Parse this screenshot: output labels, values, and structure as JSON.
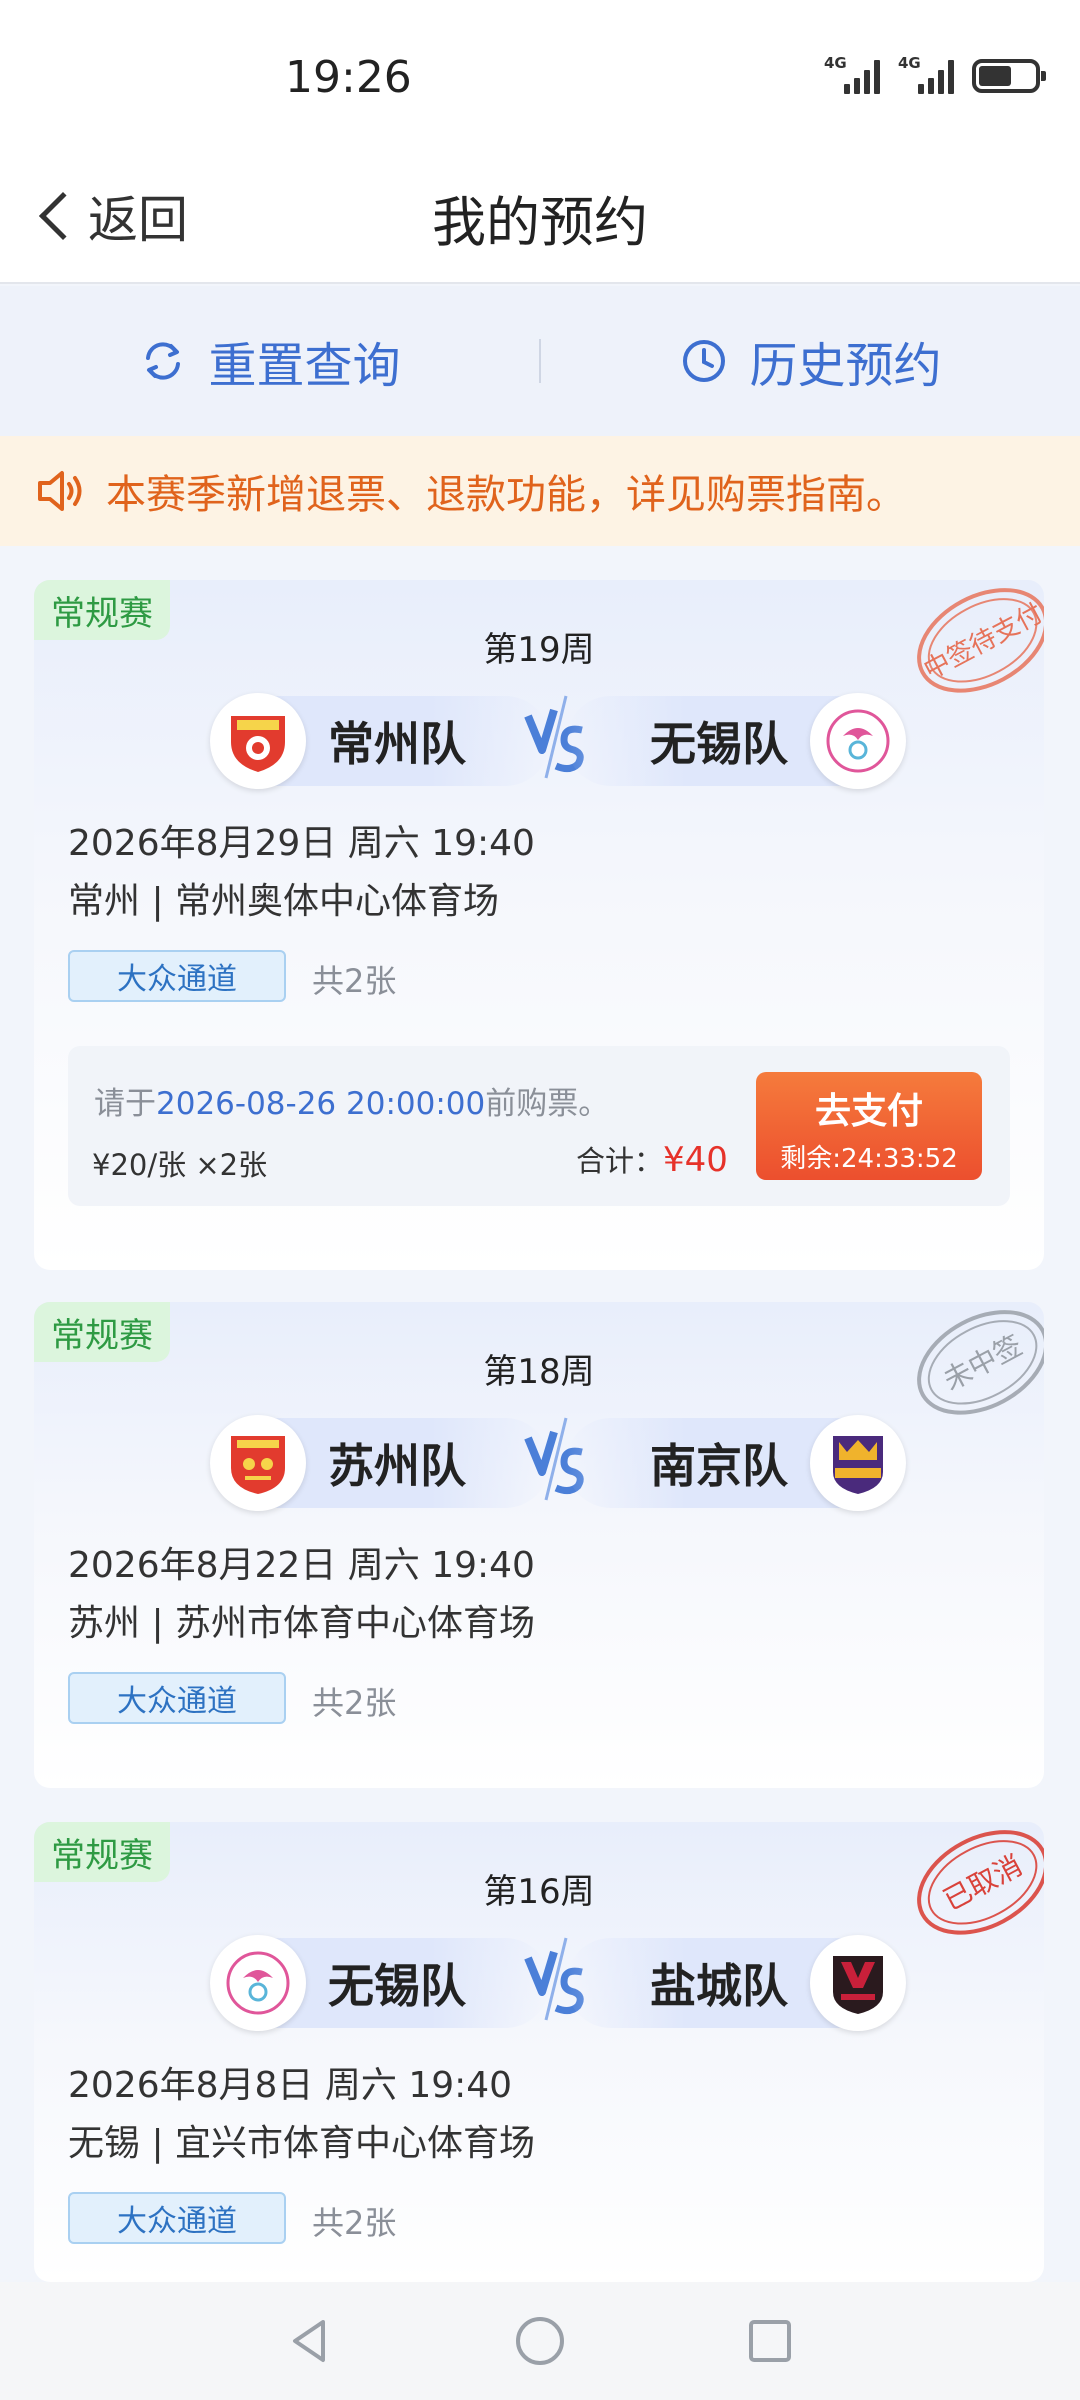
{
  "status_bar": {
    "time": "19:26",
    "network_1": "4G",
    "network_2": "4G",
    "battery_level": 0.6
  },
  "header": {
    "back_label": "返回",
    "title": "我的预约"
  },
  "actions": {
    "reset_label": "重置查询",
    "history_label": "历史预约"
  },
  "notice": {
    "text": "本赛季新增退票、退款功能，详见购票指南。"
  },
  "colors": {
    "accent": "#3d6fd0",
    "warning": "#e0631c",
    "price": "#e6322a",
    "tag_green": "#2e9a43",
    "stamp_red": "#d9423a",
    "stamp_gray": "#9aa0a8"
  },
  "cards": [
    {
      "tag": "常规赛",
      "week": "第19周",
      "home_team": "常州队",
      "away_team": "无锡队",
      "datetime": "2026年8月29日 周六 19:40",
      "venue": "常州 | 常州奥体中心体育场",
      "channel": "大众通道",
      "count": "共2张",
      "stamp": "中签待支付",
      "pay": {
        "note_prefix": "请于",
        "deadline": "2026-08-26 20:00:00",
        "note_suffix": "前购票。",
        "price": "¥20/张 ×2张",
        "total_label": "合计：",
        "total": "¥40",
        "button": "去支付",
        "remaining": "剩余:24:33:52"
      }
    },
    {
      "tag": "常规赛",
      "week": "第18周",
      "home_team": "苏州队",
      "away_team": "南京队",
      "datetime": "2026年8月22日 周六 19:40",
      "venue": "苏州 | 苏州市体育中心体育场",
      "channel": "大众通道",
      "count": "共2张",
      "stamp": "未中签"
    },
    {
      "tag": "常规赛",
      "week": "第16周",
      "home_team": "无锡队",
      "away_team": "盐城队",
      "datetime": "2026年8月8日 周六 19:40",
      "venue": "无锡 | 宜兴市体育中心体育场",
      "channel": "大众通道",
      "count": "共2张",
      "stamp": "已取消"
    }
  ],
  "icons": {
    "back": "chevron-left-icon",
    "reset": "refresh-icon",
    "history": "clock-icon",
    "notice": "speaker-icon",
    "vs": "vs-icon",
    "nav_back": "triangle-back-icon",
    "nav_home": "circle-home-icon",
    "nav_recent": "square-recent-icon"
  }
}
